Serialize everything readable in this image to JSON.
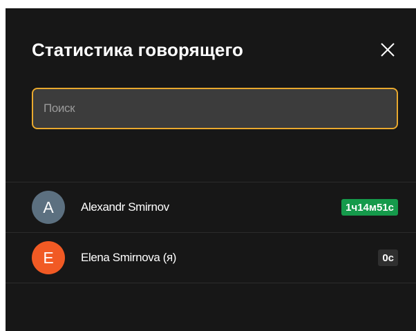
{
  "dialog": {
    "title": "Статистика говорящего",
    "close_icon": "close-icon"
  },
  "search": {
    "placeholder": "Поиск",
    "value": "",
    "focus_border_color": "#e9a92e"
  },
  "speakers": [
    {
      "initial": "A",
      "name": "Alexandr Smirnov",
      "duration": "1ч14м51с",
      "avatar_color": "#5c7080",
      "badge_color": "#159a4b"
    },
    {
      "initial": "E",
      "name": "Elena Smirnova (я)",
      "duration": "0с",
      "avatar_color": "#f15a24",
      "badge_color": "#2f2f2f"
    }
  ]
}
